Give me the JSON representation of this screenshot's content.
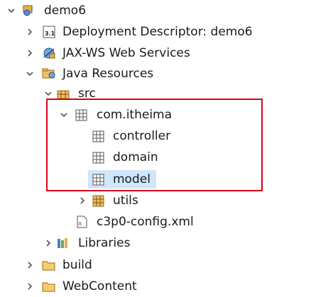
{
  "tree": {
    "project": {
      "label": "demo6"
    },
    "deployment_descriptor": {
      "label": "Deployment Descriptor: demo6"
    },
    "jax_ws": {
      "label": "JAX-WS Web Services"
    },
    "java_resources": {
      "label": "Java Resources"
    },
    "src": {
      "label": "src"
    },
    "pkg_root": {
      "label": "com.itheima"
    },
    "pkg_controller": {
      "label": "controller"
    },
    "pkg_domain": {
      "label": "domain"
    },
    "pkg_model": {
      "label": "model"
    },
    "pkg_utils": {
      "label": "utils"
    },
    "config_file": {
      "label": "c3p0-config.xml"
    },
    "libraries": {
      "label": "Libraries"
    },
    "build": {
      "label": "build"
    },
    "webcontent": {
      "label": "WebContent"
    }
  },
  "colors": {
    "highlight_frame": "#d6001c",
    "selection": "#cfe6fb"
  }
}
